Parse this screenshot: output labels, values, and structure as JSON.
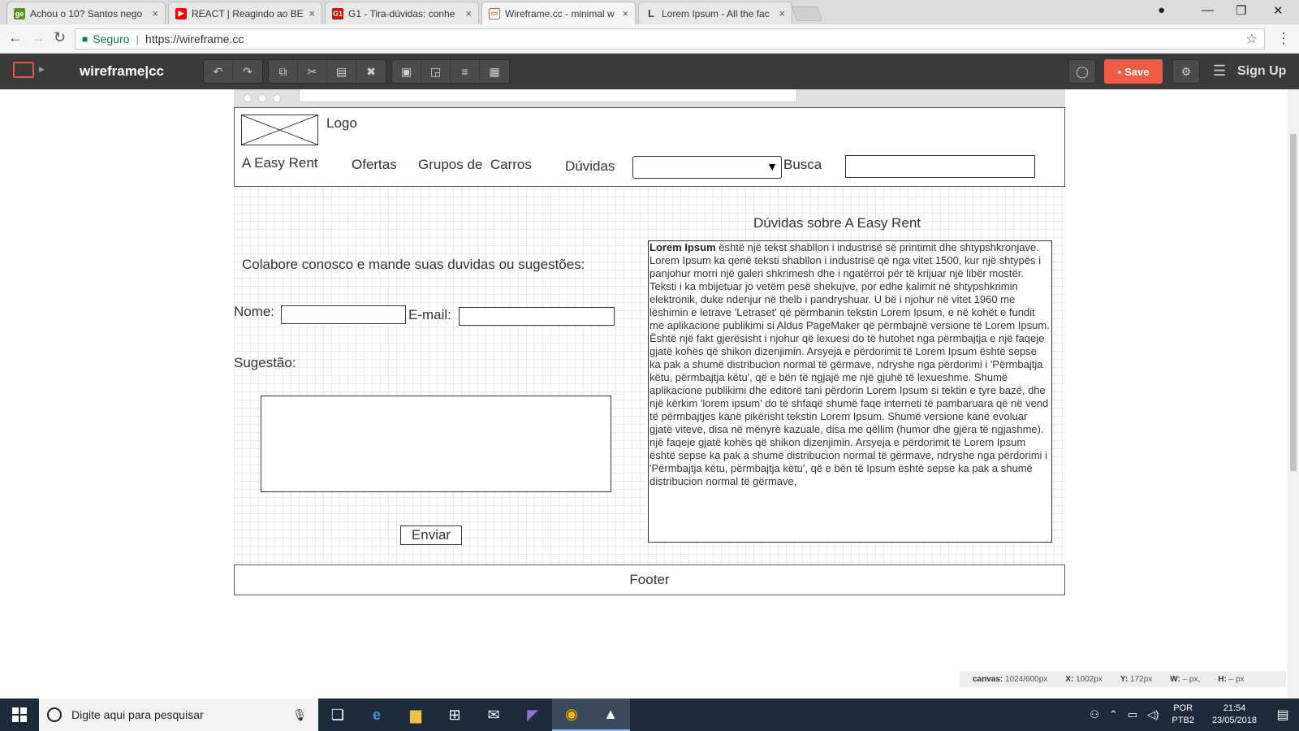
{
  "browser": {
    "tabs": [
      {
        "title": "Achou o 10? Santos nego",
        "favicon": "ge",
        "color": "#5a8f29"
      },
      {
        "title": "REACT | Reagindo ao BES",
        "favicon": "▶",
        "color": "#ff0000"
      },
      {
        "title": "G1 - Tira-dúvidas: conhe",
        "favicon": "G1",
        "color": "#c4170c"
      },
      {
        "title": "Wireframe.cc - minimal w",
        "favicon": "▭",
        "color": "#e2583e"
      },
      {
        "title": "Lorem Ipsum - All the fac",
        "favicon": "L",
        "color": "#444444"
      }
    ],
    "secure_label": "Seguro",
    "url": "https://wireframe.cc"
  },
  "app": {
    "brand": "wireframe|cc",
    "save_label": "Save",
    "signup_label": "Sign Up",
    "accent": "#ef5b45"
  },
  "page": {
    "logo_label": "Logo",
    "nav": {
      "brand": "A Easy Rent",
      "ofertas": "Ofertas",
      "grupos": "Grupos de  Carros",
      "duvidas": "Dúvidas",
      "busca": "Busca"
    },
    "contact": {
      "heading": "Colabore conosco e mande suas duvidas ou sugestões:",
      "nome_label": "Nome:",
      "email_label": "E-mail:",
      "sugestao_label": "Sugestão:",
      "submit_label": "Enviar"
    },
    "faq": {
      "title": "Dúvidas sobre A Easy Rent",
      "bold_lead": "Lorem Ipsum",
      "paragraph1": " është një tekst shabllon i industrisë së printimit dhe shtypshkronjave. Lorem Ipsum ka qenë teksti shabllon i industrisë që nga vitet 1500, kur një shtypës i panjohur morri një galeri shkrimesh dhe i ngatërroi për të krijuar një libër mostër. Teksti i ka mbijetuar jo vetëm pesë shekujve, por edhe kalimit në shtypshkrimin elektronik, duke ndenjur në thelb i pandryshuar. U bë i njohur në vitet 1960 me lëshimin e letrave 'Letraset' që përmbanin tekstin Lorem Ipsum, e në kohët e fundit me aplikacione publikimi si Aldus PageMaker që përmbajnë versione të Lorem Ipsum.",
      "paragraph2": "Është një fakt gjerësisht i njohur që lexuesi do të hutohet nga përmbajtja e një faqeje gjatë kohës që shikon dizenjimin. Arsyeja e përdorimit të Lorem Ipsum është sepse ka pak a shumë distribucion normal të gërmave, ndryshe nga përdorimi i 'Përmbajtja këtu, përmbajtja këtu', që e bën të ngjajë me një gjuhë të lexueshme. Shumë aplikacione publikimi dhe editorë tani përdorin Lorem Ipsum si tektin e tyre bazë, dhe një kërkim 'lorem ipsum' do të shfaqë shumë faqe interneti të pambaruara që në vend të përmbajtjes kanë pikërisht tekstin Lorem Ipsum. Shumë versione kanë evoluar gjatë viteve, disa në mënyrë kazuale, disa me qëllim (humor dhe gjëra të ngjashme).",
      "paragraph3": "një faqeje gjatë kohës që shikon dizenjimin. Arsyeja e përdorimit të Lorem Ipsum është sepse ka pak a shumë distribucion normal të gërmave, ndryshe nga përdorimi i 'Përmbajtja këtu, përmbajtja këtu', që e bën të Ipsum është sepse ka pak a shumë distribucion normal të gërmave,"
    },
    "footer": "Footer"
  },
  "status": {
    "canvas_label": "canvas:",
    "canvas_value": "1024/600px",
    "x_label": "X:",
    "x_value": "1002px",
    "y_label": "Y:",
    "y_value": "172px",
    "w_label": "W:",
    "w_value": "– px,",
    "h_label": "H:",
    "h_value": "– px"
  },
  "taskbar": {
    "search_placeholder": "Digite aqui para pesquisar",
    "lang_top": "POR",
    "lang_bottom": "PTB2",
    "time": "21:54",
    "date": "23/05/2018"
  }
}
